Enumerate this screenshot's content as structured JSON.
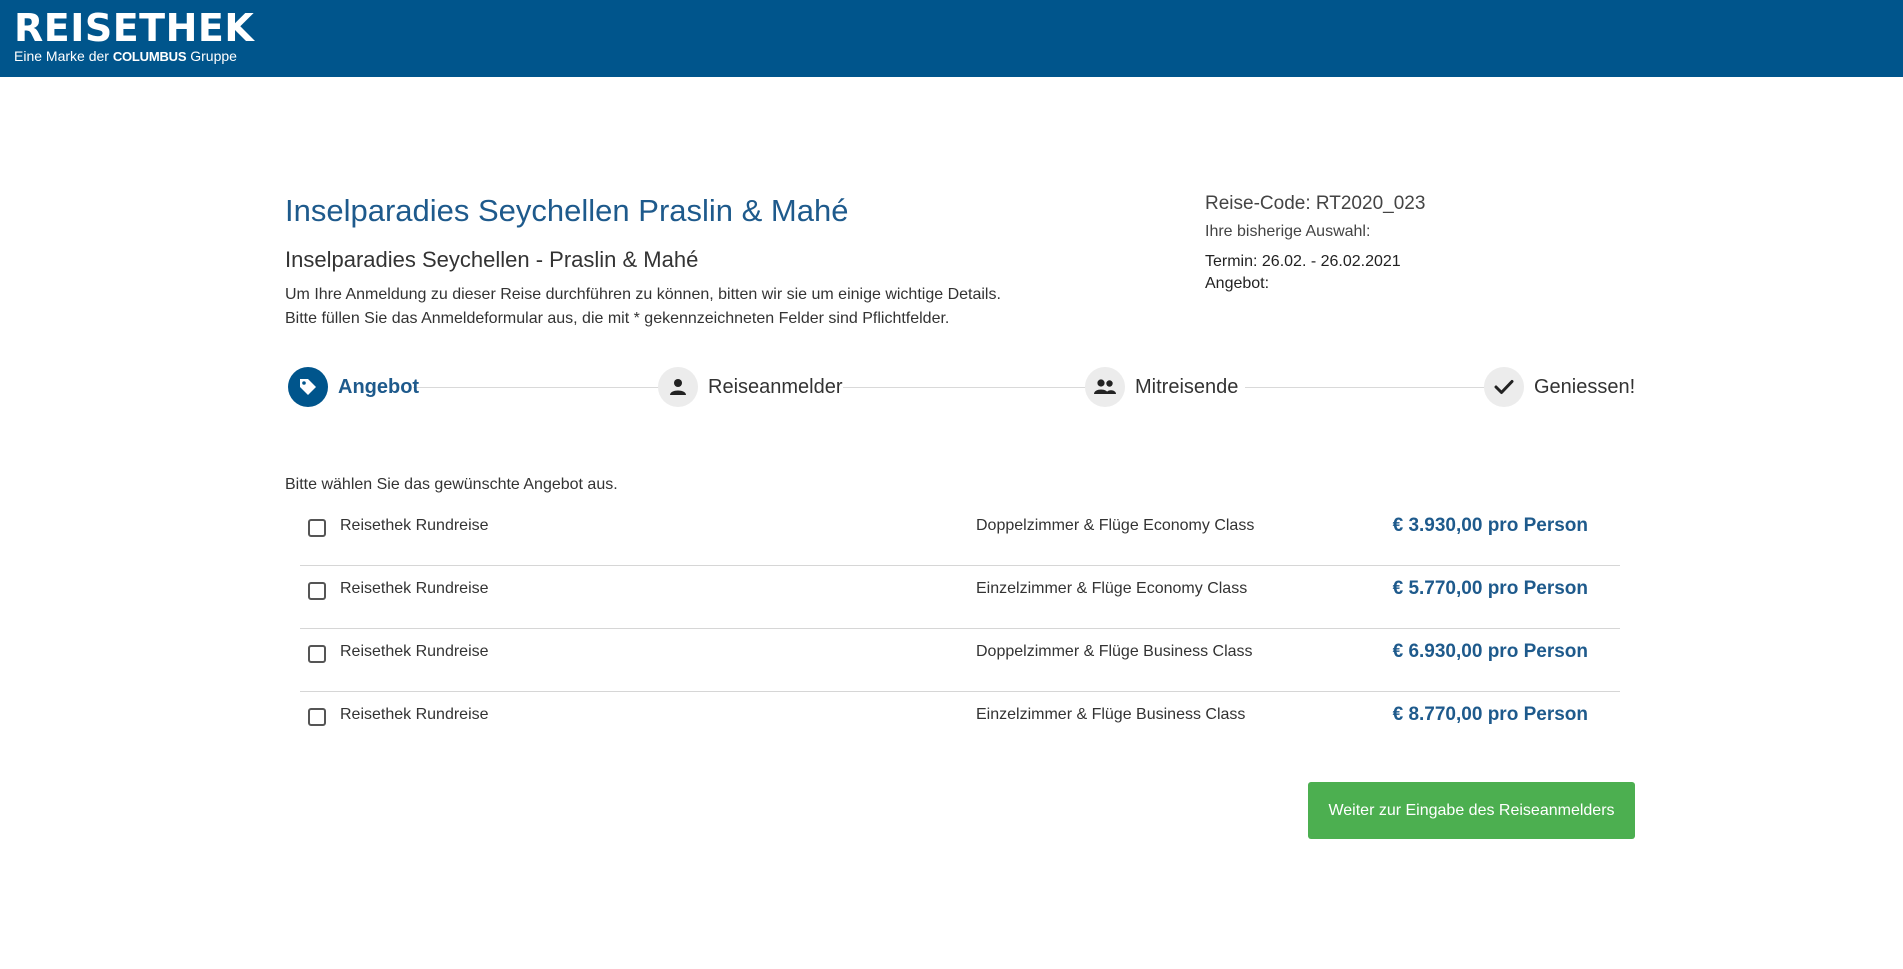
{
  "header": {
    "logo_word": "REISETHEK",
    "logo_tag_prefix": "Eine Marke der",
    "logo_tag_brand": "COLUMBUS",
    "logo_tag_suffix": "Gruppe",
    "background_color": "#00558c"
  },
  "trip": {
    "title": "Inselparadies Seychellen Praslin & Mahé",
    "subtitle": "Inselparadies Seychellen - Praslin & Mahé",
    "intro_line1": "Um Ihre Anmeldung zu dieser Reise durchführen zu können, bitten wir sie um einige wichtige Details.",
    "intro_line2": "Bitte füllen Sie das Anmeldeformular aus, die mit * gekennzeichneten Felder sind Pflichtfelder."
  },
  "info": {
    "code": "Reise-Code: RT2020_023",
    "selection_label": "Ihre bisherige Auswahl:",
    "termin": "Termin: 26.02. - 26.02.2021",
    "angebot": "Angebot:"
  },
  "stepper": {
    "steps": [
      {
        "label": "Angebot",
        "icon": "tag-icon",
        "active": true
      },
      {
        "label": "Reiseanmelder",
        "icon": "user-icon",
        "active": false
      },
      {
        "label": "Mitreisende",
        "icon": "users-icon",
        "active": false
      },
      {
        "label": "Geniessen!",
        "icon": "check-icon",
        "active": false
      }
    ]
  },
  "offers": {
    "prompt": "Bitte wählen Sie das gewünschte Angebot aus.",
    "items": [
      {
        "name": "Reisethek Rundreise",
        "room": "Doppelzimmer & Flüge Economy Class",
        "price": "€ 3.930,00 pro Person",
        "checked": false
      },
      {
        "name": "Reisethek Rundreise",
        "room": "Einzelzimmer & Flüge Economy Class",
        "price": "€ 5.770,00 pro Person",
        "checked": false
      },
      {
        "name": "Reisethek Rundreise",
        "room": "Doppelzimmer & Flüge Business Class",
        "price": "€ 6.930,00 pro Person",
        "checked": false
      },
      {
        "name": "Reisethek Rundreise",
        "room": "Einzelzimmer & Flüge Business Class",
        "price": "€ 8.770,00 pro Person",
        "checked": false
      }
    ]
  },
  "actions": {
    "next_label": "Weiter zur Eingabe des Reiseanmelders",
    "next_color": "#4caf50"
  },
  "colors": {
    "accent": "#1e5a8c",
    "step_inactive": "#ececec"
  }
}
